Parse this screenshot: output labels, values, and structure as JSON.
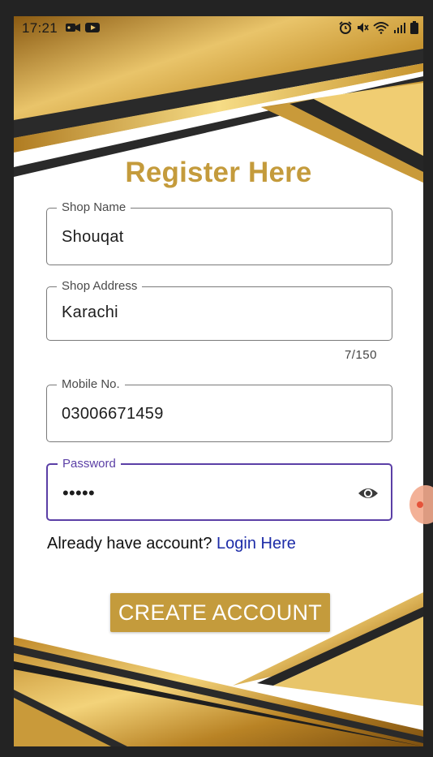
{
  "status_bar": {
    "time": "17:21",
    "left_icons": [
      "video-camera-icon",
      "youtube-icon"
    ],
    "right_icons": [
      "alarm-icon",
      "mute-icon",
      "wifi-icon",
      "signal-icon",
      "battery-icon"
    ]
  },
  "form": {
    "title": "Register Here",
    "shop_name": {
      "label": "Shop Name",
      "value": "Shouqat"
    },
    "shop_address": {
      "label": "Shop Address",
      "value": "Karachi",
      "counter": "7/150"
    },
    "mobile": {
      "label": "Mobile No.",
      "value": "03006671459"
    },
    "password": {
      "label": "Password",
      "value": "•••••",
      "visibility_icon": "eye-icon"
    },
    "login_prompt": "Already have account?",
    "login_link": "Login Here",
    "create_button": "CREATE ACCOUNT"
  },
  "colors": {
    "accent_gold": "#c49b3c",
    "focus_purple": "#5b3fa6",
    "link_blue": "#1d2ca8",
    "dark_band": "#2b2b2b"
  }
}
